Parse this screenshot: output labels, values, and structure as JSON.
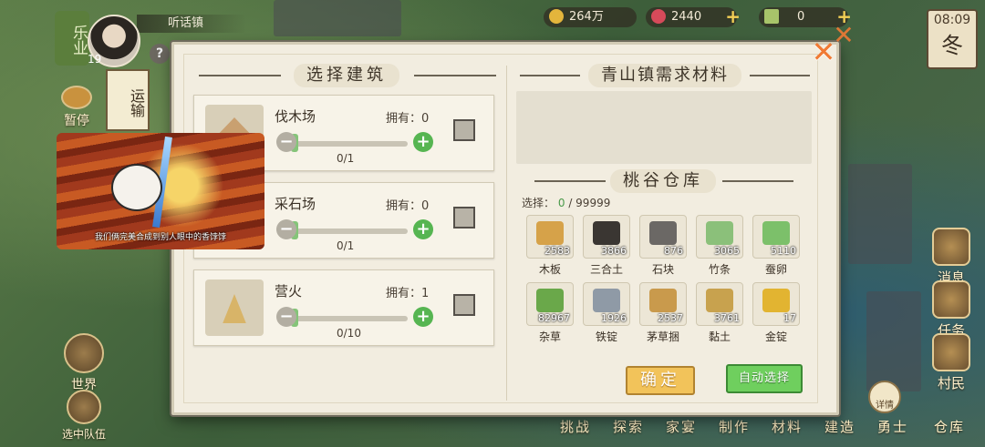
{
  "hud": {
    "town_badge": "乐业",
    "player_level": "19",
    "town_name": "听话镇",
    "coins": "264万",
    "gems": "2440",
    "tickets": "0",
    "clock_time": "08:09",
    "season": "冬"
  },
  "left_menu": {
    "transport": "运输",
    "pause": "暂停",
    "world": "世界",
    "select_team": "选中队伍"
  },
  "right_menu": {
    "messages": "消息",
    "tasks": "任务",
    "villagers": "村民",
    "details": "详情"
  },
  "bottom_nav": [
    "挑战",
    "探索",
    "家宴",
    "制作",
    "材料",
    "建造",
    "勇士",
    "仓库"
  ],
  "video": {
    "caption": "我们俩完美合成到别人眼中的香饽饽"
  },
  "modal": {
    "left_title": "选择建筑",
    "demand_title": "青山镇需求材料",
    "warehouse_title": "桃谷仓库",
    "select_label": "选择：",
    "select_current": "0",
    "select_max": "/ 99999",
    "confirm": "确定",
    "auto_select": "自动选择",
    "buildings": [
      {
        "name": "伐木场",
        "owned": "拥有：0",
        "count": "0/1",
        "color": "#c9a070"
      },
      {
        "name": "采石场",
        "owned": "拥有：0",
        "count": "0/1",
        "color": "#a8a39a"
      },
      {
        "name": "营火",
        "owned": "拥有：1",
        "count": "0/10",
        "color": "#d8b468"
      }
    ],
    "inventory": [
      {
        "name": "木板",
        "qty": "2583",
        "color": "#d6a249"
      },
      {
        "name": "三合土",
        "qty": "3866",
        "color": "#3a3632"
      },
      {
        "name": "石块",
        "qty": "876",
        "color": "#6b6865"
      },
      {
        "name": "竹条",
        "qty": "3065",
        "color": "#8bc07a"
      },
      {
        "name": "蚕卵",
        "qty": "5110",
        "color": "#7cc06a"
      },
      {
        "name": "杂草",
        "qty": "82967",
        "color": "#6aa84a"
      },
      {
        "name": "铁锭",
        "qty": "1926",
        "color": "#8f9aa6"
      },
      {
        "name": "茅草捆",
        "qty": "2537",
        "color": "#c99a4c"
      },
      {
        "name": "黏土",
        "qty": "3761",
        "color": "#c8a24e"
      },
      {
        "name": "金锭",
        "qty": "17",
        "color": "#e2b431"
      }
    ]
  }
}
